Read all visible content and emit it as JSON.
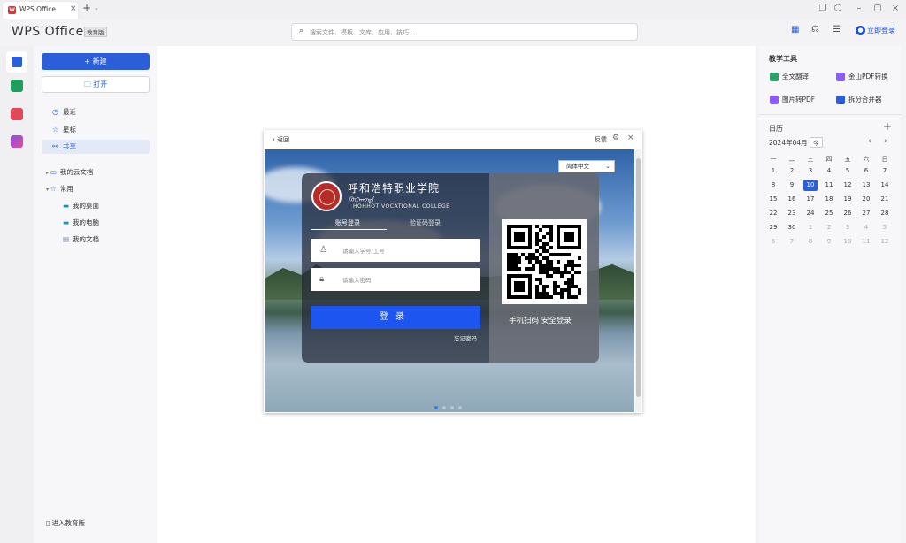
{
  "titlebar": {
    "tab_title": "WPS Office",
    "tab_logo": "W",
    "new_tab": "+",
    "tab_menu": "⌄"
  },
  "header": {
    "brand": "WPS Office",
    "edition_badge": "教育版",
    "search_placeholder": "搜索文件、模板、文库、应用、技巧...",
    "login_label": "立即登录"
  },
  "sidebar": {
    "new_label": "新建",
    "open_label": "打开",
    "nav": [
      {
        "label": "最近",
        "icon": "clock-icon"
      },
      {
        "label": "星标",
        "icon": "star-icon"
      },
      {
        "label": "共享",
        "icon": "share-icon"
      }
    ],
    "cloud_docs": "我的云文档",
    "common": "常用",
    "common_items": [
      "我的桌面",
      "我的电脑",
      "我的文档"
    ],
    "edu_entry": "进入教育版"
  },
  "right_panel": {
    "tools_title": "教学工具",
    "tools": [
      {
        "label": "全文翻译",
        "color": "#2aa36b"
      },
      {
        "label": "金山PDF转换",
        "color": "#8b5cf6"
      },
      {
        "label": "图片转PDF",
        "color": "#8b5cf6"
      },
      {
        "label": "拆分合并器",
        "color": "#2b5fd9"
      }
    ],
    "calendar_title": "日历",
    "calendar_add": "+",
    "month": "2024年04月",
    "today_btn": "今",
    "weekdays": [
      "一",
      "二",
      "三",
      "四",
      "五",
      "六",
      "日"
    ],
    "days": [
      [
        "1",
        "2",
        "3",
        "4",
        "5",
        "6",
        "7"
      ],
      [
        "8",
        "9",
        "10",
        "11",
        "12",
        "13",
        "14"
      ],
      [
        "15",
        "16",
        "17",
        "18",
        "19",
        "20",
        "21"
      ],
      [
        "22",
        "23",
        "24",
        "25",
        "26",
        "27",
        "28"
      ],
      [
        "29",
        "30",
        "1",
        "2",
        "3",
        "4",
        "5"
      ],
      [
        "6",
        "7",
        "8",
        "9",
        "10",
        "11",
        "12"
      ]
    ],
    "today": "10"
  },
  "dialog": {
    "back": "返回",
    "feedback": "反馈",
    "language": "简体中文",
    "college_cn": "呼和浩特职业学院",
    "college_mn": "ᠬᠥᠬᠡᠬᠣᠲᠠ",
    "college_en": "HOHHOT VOCATIONAL COLLEGE",
    "tab_account": "账号登录",
    "tab_sms": "验证码登录",
    "user_placeholder": "请输入学号/工号",
    "pass_placeholder": "请输入密码",
    "login_button": "登录",
    "forgot": "忘记密码",
    "qr_caption": "手机扫码 安全登录"
  },
  "colors": {
    "accent": "#2b5fd9",
    "login_button": "#1d55f0"
  }
}
